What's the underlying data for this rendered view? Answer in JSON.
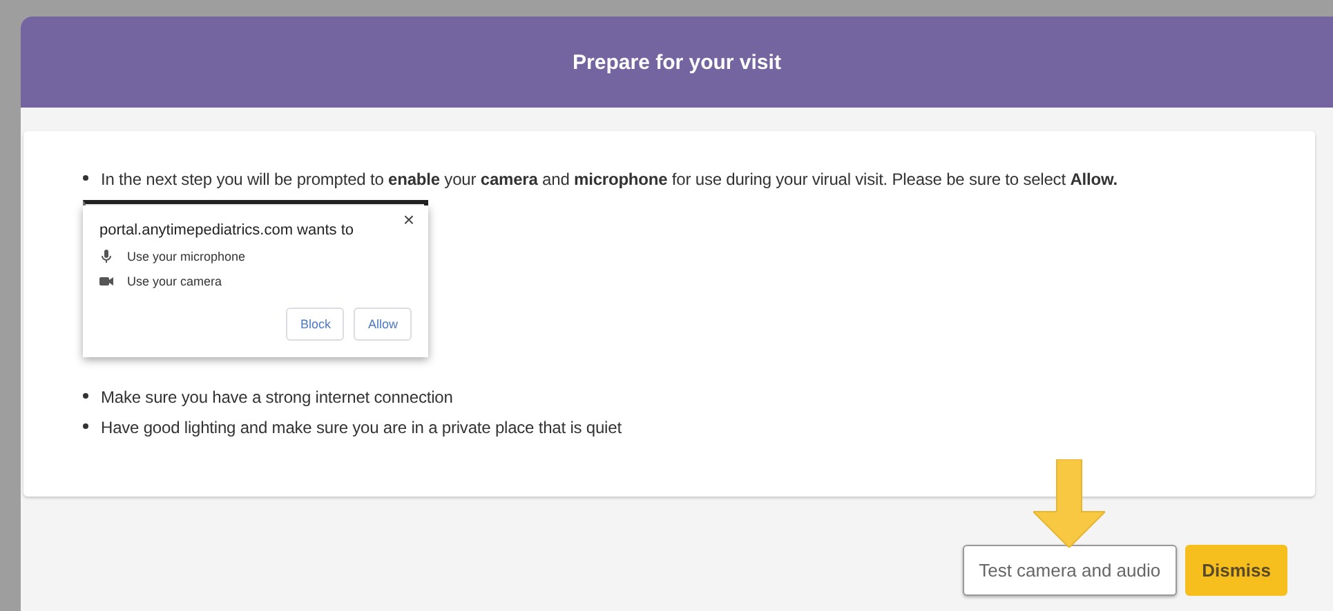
{
  "header": {
    "title": "Prepare for your visit"
  },
  "instructions": [
    {
      "text": "In the next step you will be prompted to **enable** your **camera** and **microphone** for use during your virual visit. Please be sure to select **Allow.**"
    },
    {
      "text": "Make sure you have a strong internet connection"
    },
    {
      "text": "Have good lighting and make sure you are in a private place that is quiet"
    }
  ],
  "permission_prompt": {
    "message": "portal.anytimepediatrics.com wants to",
    "close": "×",
    "permissions": [
      {
        "kind": "microphone",
        "label": "Use your microphone"
      },
      {
        "kind": "camera",
        "label": "Use your camera"
      }
    ],
    "buttons": [
      "Block",
      "Allow"
    ]
  },
  "footer": {
    "buttons": [
      {
        "label": "Test camera and audio",
        "kind": "secondary",
        "highlighted": true
      },
      {
        "label": "Dismiss",
        "kind": "primary",
        "highlighted": false
      }
    ]
  }
}
